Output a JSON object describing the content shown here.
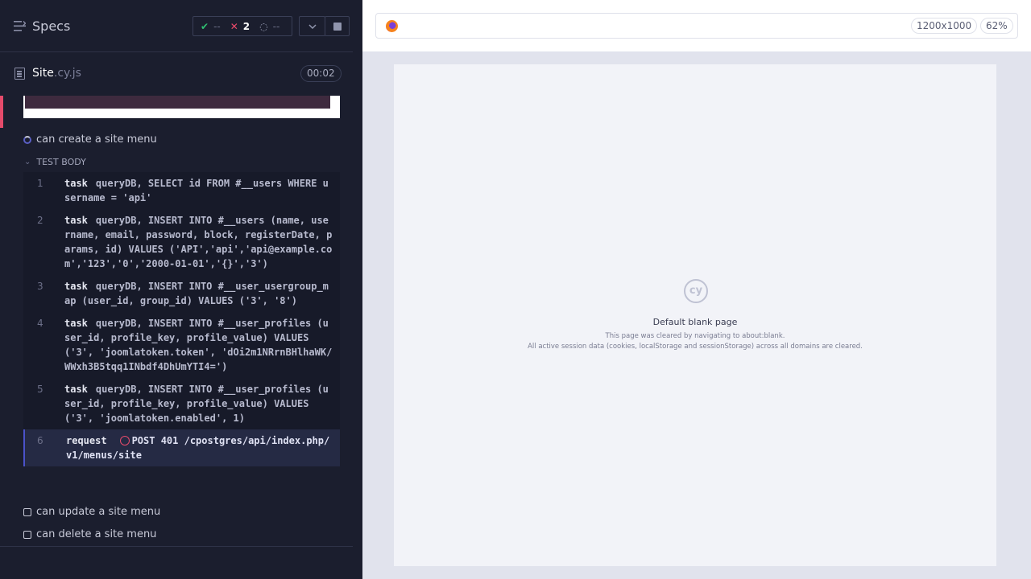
{
  "header": {
    "title": "Specs",
    "stats": {
      "passed": "--",
      "failed": "2",
      "pending": "--"
    }
  },
  "spec": {
    "name": "Site",
    "ext": ".cy.js",
    "duration": "00:02"
  },
  "tests": {
    "current": "can create a site menu",
    "section_label": "TEST BODY",
    "commands": [
      {
        "num": "1",
        "kw": "task",
        "text": "queryDB, SELECT id FROM #__users WHERE username = 'api'"
      },
      {
        "num": "2",
        "kw": "task",
        "text": "queryDB, INSERT INTO #__users (name, username, email, password, block, registerDate, params, id) VALUES ('API','api','api@example.com','123','0','2000-01-01','{}','3')"
      },
      {
        "num": "3",
        "kw": "task",
        "text": "queryDB, INSERT INTO #__user_usergroup_map (user_id, group_id) VALUES ('3', '8')"
      },
      {
        "num": "4",
        "kw": "task",
        "text": "queryDB, INSERT INTO #__user_profiles (user_id, profile_key, profile_value) VALUES ('3', 'joomlatoken.token', 'dOi2m1NRrnBHlhaWK/WWxh3B5tqq1INbdf4DhUmYTI4=')"
      },
      {
        "num": "5",
        "kw": "task",
        "text": "queryDB, INSERT INTO #__user_profiles (user_id, profile_key, profile_value) VALUES ('3', 'joomlatoken.enabled', 1)"
      },
      {
        "num": "6",
        "kw": "request",
        "text": "POST 401 /cpostgres/api/index.php/v1/menus/site"
      }
    ],
    "pending": [
      "can update a site menu",
      "can delete a site menu"
    ]
  },
  "aut": {
    "viewport": "1200x1000",
    "zoom": "62%",
    "logo_text": "cy",
    "blank_title": "Default blank page",
    "blank_line1": "This page was cleared by navigating to about:blank.",
    "blank_line2": "All active session data (cookies, localStorage and sessionStorage) across all domains are cleared."
  },
  "colors": {
    "failed": "#e54b6b",
    "passed": "#2fbf71",
    "accent": "#4b52c9"
  }
}
